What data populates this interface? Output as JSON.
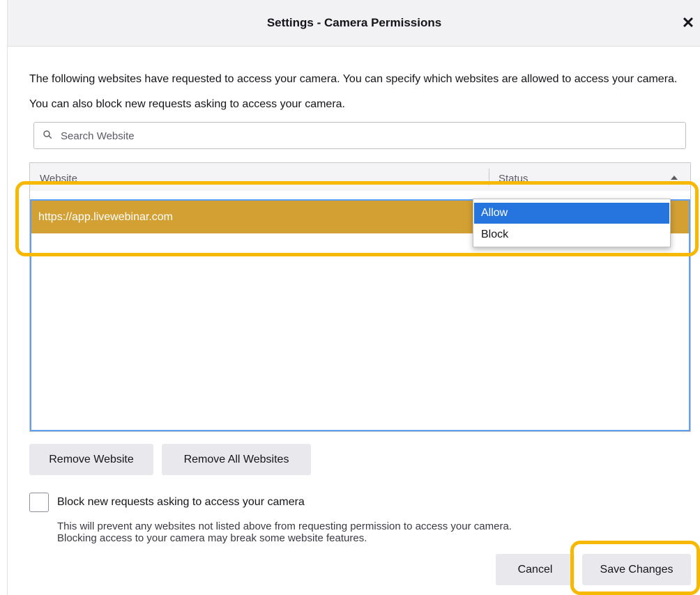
{
  "dialog": {
    "title": "Settings - Camera Permissions",
    "close_glyph": "✕",
    "description": "The following websites have requested to access your camera. You can specify which websites are allowed to access your camera. You can also block new requests asking to access your camera."
  },
  "search": {
    "placeholder": "Search Website",
    "value": "",
    "icon": "search-icon"
  },
  "table": {
    "columns": [
      "Website",
      "Status"
    ],
    "rows": [
      {
        "website": "https://app.livewebinar.com",
        "status": "Allow"
      }
    ]
  },
  "status_dropdown": {
    "options": [
      "Allow",
      "Block"
    ],
    "selected": "Allow"
  },
  "buttons": {
    "remove_website": "Remove Website",
    "remove_all": "Remove All Websites",
    "cancel": "Cancel",
    "save": "Save Changes"
  },
  "block_new": {
    "checked": false,
    "label": "Block new requests asking to access your camera",
    "help_line1": "This will prevent any websites not listed above from requesting permission to access your camera.",
    "help_line2": "Blocking access to your camera may break some website features."
  },
  "colors": {
    "highlight": "#f6b800",
    "selected_row": "#d3a034",
    "selected_option": "#2675df",
    "focus_ring": "#5e9ff2"
  }
}
